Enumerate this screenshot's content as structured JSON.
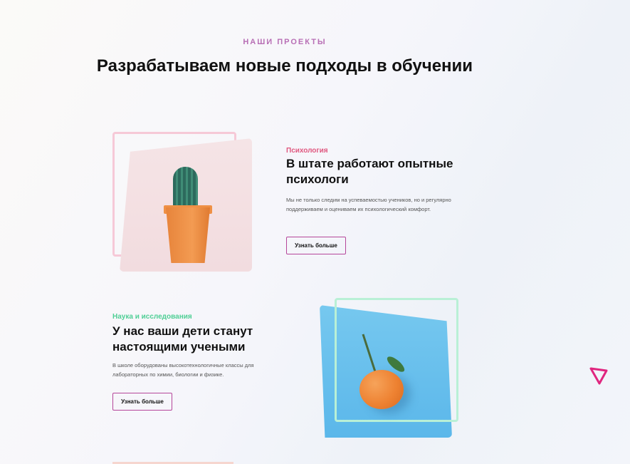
{
  "section": {
    "eyebrow": "НАШИ ПРОЕКТЫ",
    "title": "Разрабатываем новые подходы в обучении"
  },
  "projects": [
    {
      "category": "Психология",
      "title": "В штате работают опытные психологи",
      "description": "Мы не только следим на успеваемостью учеников, но и регулярно поддерживаем и оцениваем их психологический комфорт.",
      "button_label": "Узнать больше",
      "accent_color": "#e0577f"
    },
    {
      "category": "Наука и исследования",
      "title": "У нас ваши дети станут настоящими учеными",
      "description": "В школе оборудованы высокотехнологичные классы для лабораторных по химии, биологии и физике.",
      "button_label": "Узнать больше",
      "accent_color": "#4fcf95"
    }
  ],
  "icons": {
    "decoration": "triangle-outline-icon"
  },
  "colors": {
    "eyebrow": "#b86fb5",
    "button_border": "#b5469a",
    "triangle": "#e0267f"
  }
}
